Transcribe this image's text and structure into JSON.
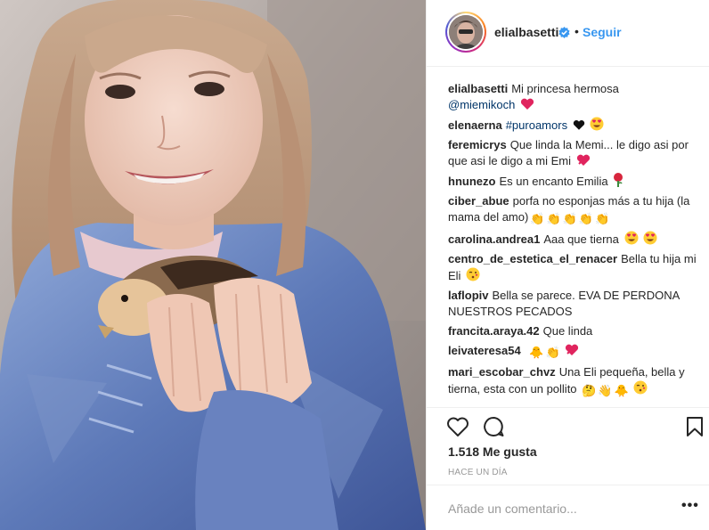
{
  "post": {
    "username": "elialbasetti",
    "follow_label": "Seguir",
    "separator": "•",
    "verified_icon": "verified-badge-icon",
    "photo_icon": "photo-girl-holding-chick"
  },
  "caption": {
    "user": "elialbasetti",
    "text": "Mi princesa hermosa",
    "mention": "@miemikoch",
    "emoji": [
      "red-heart"
    ]
  },
  "comments": [
    {
      "user": "elenaerna",
      "hashtag": "#puroamors",
      "text": "",
      "emoji": [
        "black-heart",
        "heart-eyes"
      ]
    },
    {
      "user": "feremicrys",
      "text": "Que linda la Memi... le digo asi por que asi le digo a mi Emi",
      "emoji": [
        "heart-exclamation"
      ]
    },
    {
      "user": "hnunezo",
      "text": "Es un encanto Emilia",
      "emoji": [
        "rose"
      ]
    },
    {
      "user": "ciber_abue",
      "text": "porfa no esponjas más a tu hija (la mama del amo)",
      "emoji": [
        "clap",
        "clap",
        "clap",
        "clap",
        "clap"
      ]
    },
    {
      "user": "carolina.andrea1",
      "text": "Aaa que tierna",
      "emoji": [
        "heart-eyes",
        "heart-eyes"
      ]
    },
    {
      "user": "centro_de_estetica_el_renacer",
      "text": "Bella tu hija mi Eli",
      "emoji": [
        "kiss-face"
      ]
    },
    {
      "user": "laflopiv",
      "text": "Bella se parece. EVA DE PERDONA NUESTROS PECADOS",
      "emoji": []
    },
    {
      "user": "francita.araya.42",
      "text": "Que linda",
      "emoji": []
    },
    {
      "user": "leivateresa54",
      "text": "",
      "emoji": [
        "chick",
        "clap",
        "heart-exclamation"
      ]
    },
    {
      "user": "mari_escobar_chvz",
      "text": "Una Eli pequeña, bella y tierna, esta con un pollito",
      "emoji": [
        "thinking",
        "wave-hand",
        "chick",
        "kiss-face"
      ]
    }
  ],
  "actions": {
    "like_icon": "heart-outline-icon",
    "comment_icon": "comment-bubble-icon",
    "save_icon": "bookmark-icon"
  },
  "likes": {
    "text": "1.518 Me gusta"
  },
  "timestamp": "HACE UN DÍA",
  "add_comment": {
    "placeholder": "Añade un comentario...",
    "more_label": "•••"
  },
  "colors": {
    "link": "#003569",
    "follow": "#3897f0",
    "muted": "#999999",
    "text": "#262626",
    "heart": "#ed4956"
  }
}
